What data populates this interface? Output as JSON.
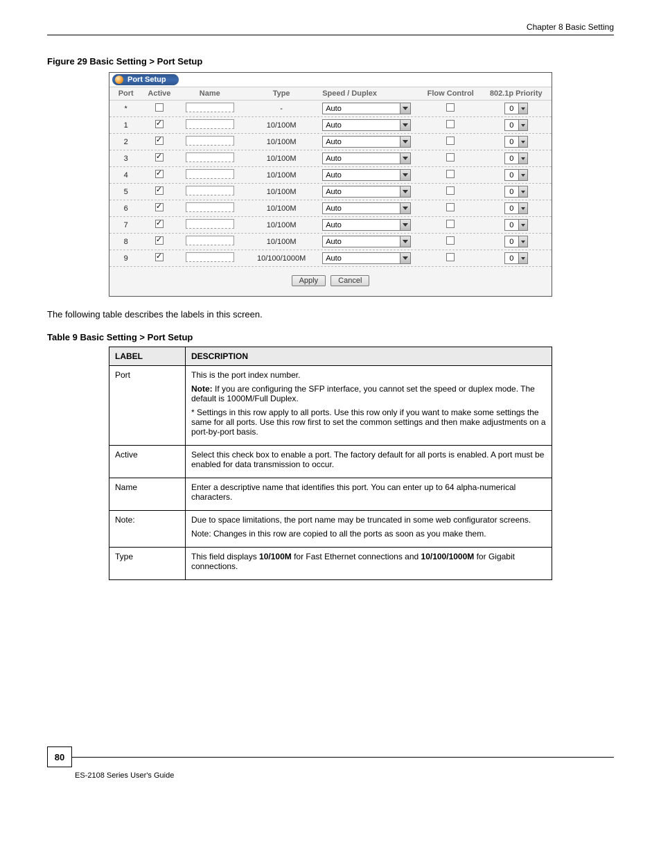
{
  "header": {
    "chapter": "Chapter 8 Basic Setting"
  },
  "figure": {
    "caption": "Figure 29   Basic Setting > Port Setup",
    "panel_title": "Port Setup",
    "columns": {
      "port": "Port",
      "active": "Active",
      "name": "Name",
      "type": "Type",
      "speed": "Speed / Duplex",
      "flow": "Flow Control",
      "priority": "802.1p Priority"
    },
    "rows": [
      {
        "port": "*",
        "active": false,
        "name": "",
        "type": "-",
        "speed": "Auto",
        "flow": false,
        "priority": "0"
      },
      {
        "port": "1",
        "active": true,
        "name": "",
        "type": "10/100M",
        "speed": "Auto",
        "flow": false,
        "priority": "0"
      },
      {
        "port": "2",
        "active": true,
        "name": "",
        "type": "10/100M",
        "speed": "Auto",
        "flow": false,
        "priority": "0"
      },
      {
        "port": "3",
        "active": true,
        "name": "",
        "type": "10/100M",
        "speed": "Auto",
        "flow": false,
        "priority": "0"
      },
      {
        "port": "4",
        "active": true,
        "name": "",
        "type": "10/100M",
        "speed": "Auto",
        "flow": false,
        "priority": "0"
      },
      {
        "port": "5",
        "active": true,
        "name": "",
        "type": "10/100M",
        "speed": "Auto",
        "flow": false,
        "priority": "0"
      },
      {
        "port": "6",
        "active": true,
        "name": "",
        "type": "10/100M",
        "speed": "Auto",
        "flow": false,
        "priority": "0"
      },
      {
        "port": "7",
        "active": true,
        "name": "",
        "type": "10/100M",
        "speed": "Auto",
        "flow": false,
        "priority": "0"
      },
      {
        "port": "8",
        "active": true,
        "name": "",
        "type": "10/100M",
        "speed": "Auto",
        "flow": false,
        "priority": "0"
      },
      {
        "port": "9",
        "active": true,
        "name": "",
        "type": "10/100/1000M",
        "speed": "Auto",
        "flow": false,
        "priority": "0"
      }
    ],
    "buttons": {
      "apply": "Apply",
      "cancel": "Cancel"
    }
  },
  "lead_text": "The following table describes the labels in this screen.",
  "desc_table": {
    "caption": "Table 9   Basic Setting > Port Setup",
    "head": {
      "label": "LABEL",
      "description": "DESCRIPTION"
    },
    "rows": [
      {
        "label": "Port",
        "desc": [
          "This is the port index number.",
          {
            "p": "Note: If you are configuring the SFP interface, you cannot set the speed or duplex mode. The default is 1000M/Full Duplex.",
            "bold_prefix": "Note: "
          },
          "* Settings in this row apply to all ports. Use this row only if you want to make some settings the same for all ports. Use this row first to set the common settings and then make adjustments on a port-by-port basis."
        ]
      },
      {
        "label": "Active",
        "desc": [
          "Select this check box to enable a port. The factory default for all ports is enabled. A port must be enabled for data transmission to occur."
        ]
      },
      {
        "label": "Name",
        "desc": [
          "Enter a descriptive name that identifies this port. You can enter up to 64 alpha-numerical characters."
        ]
      },
      {
        "label": "Note:",
        "desc": [
          "Due to space limitations, the port name may be truncated in some web configurator screens.",
          "Note: Changes in this row are copied to all the ports as soon as you make them."
        ]
      },
      {
        "label": "Type",
        "desc": [
          {
            "p": "This field displays 10/100M for Fast Ethernet connections and 10/100/1000M for Gigabit connections.",
            "bold_terms": [
              "10/100M",
              "10/100/1000M"
            ]
          }
        ]
      }
    ]
  },
  "footer": {
    "page": "80",
    "manual": "ES-2108 Series User's Guide"
  }
}
